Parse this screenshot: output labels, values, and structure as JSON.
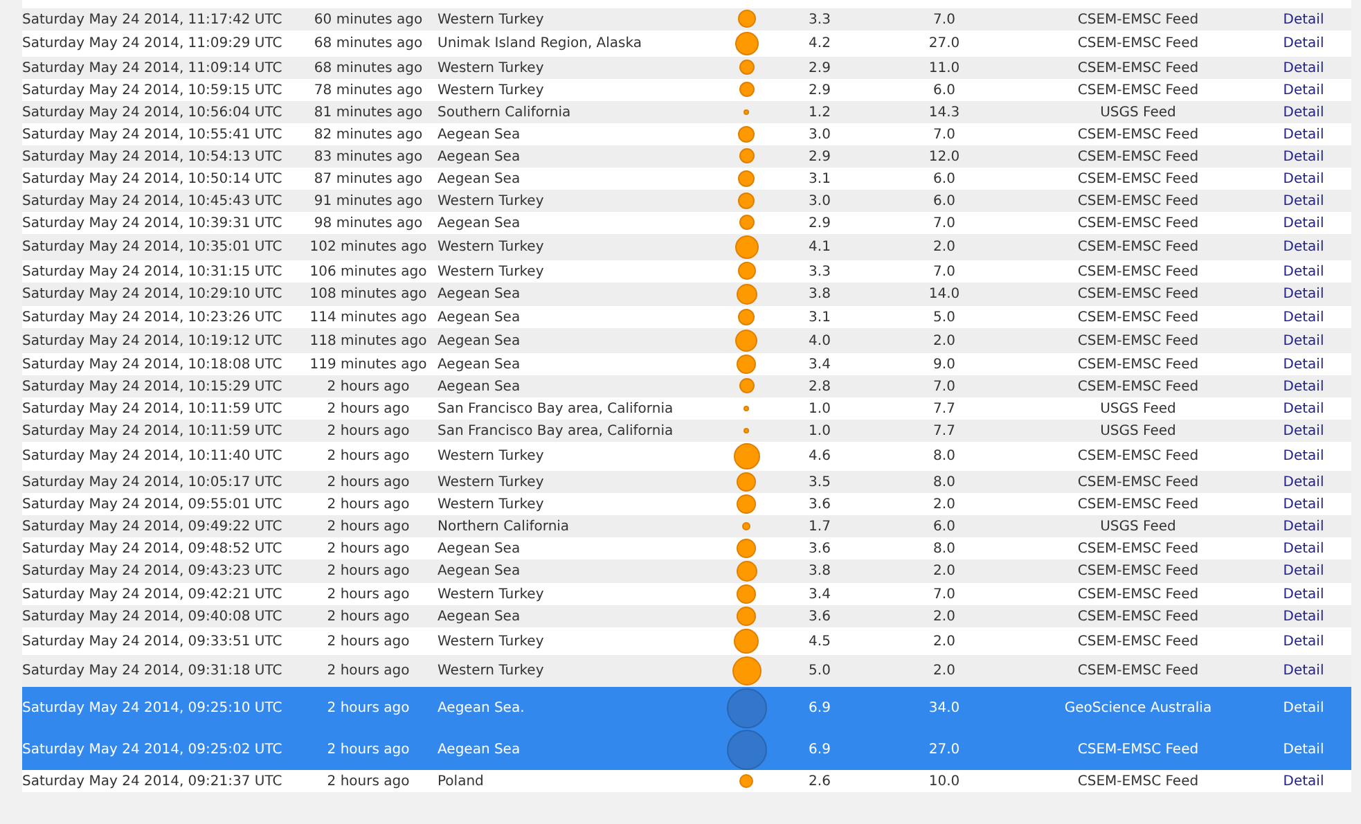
{
  "rows": [
    {
      "date": "Saturday May 24 2014, 11:17:42 UTC",
      "ago": "60 minutes ago",
      "region": "Western Turkey",
      "magnitude": "3.3",
      "depth": "7.0",
      "source": "CSEM-EMSC Feed",
      "link": "Detail",
      "selected": false
    },
    {
      "date": "Saturday May 24 2014, 11:09:29 UTC",
      "ago": "68 minutes ago",
      "region": "Unimak Island Region, Alaska",
      "magnitude": "4.2",
      "depth": "27.0",
      "source": "CSEM-EMSC Feed",
      "link": "Detail",
      "selected": false
    },
    {
      "date": "Saturday May 24 2014, 11:09:14 UTC",
      "ago": "68 minutes ago",
      "region": "Western Turkey",
      "magnitude": "2.9",
      "depth": "11.0",
      "source": "CSEM-EMSC Feed",
      "link": "Detail",
      "selected": false
    },
    {
      "date": "Saturday May 24 2014, 10:59:15 UTC",
      "ago": "78 minutes ago",
      "region": "Western Turkey",
      "magnitude": "2.9",
      "depth": "6.0",
      "source": "CSEM-EMSC Feed",
      "link": "Detail",
      "selected": false
    },
    {
      "date": "Saturday May 24 2014, 10:56:04 UTC",
      "ago": "81 minutes ago",
      "region": "Southern California",
      "magnitude": "1.2",
      "depth": "14.3",
      "source": "USGS Feed",
      "link": "Detail",
      "selected": false
    },
    {
      "date": "Saturday May 24 2014, 10:55:41 UTC",
      "ago": "82 minutes ago",
      "region": "Aegean Sea",
      "magnitude": "3.0",
      "depth": "7.0",
      "source": "CSEM-EMSC Feed",
      "link": "Detail",
      "selected": false
    },
    {
      "date": "Saturday May 24 2014, 10:54:13 UTC",
      "ago": "83 minutes ago",
      "region": "Aegean Sea",
      "magnitude": "2.9",
      "depth": "12.0",
      "source": "CSEM-EMSC Feed",
      "link": "Detail",
      "selected": false
    },
    {
      "date": "Saturday May 24 2014, 10:50:14 UTC",
      "ago": "87 minutes ago",
      "region": "Aegean Sea",
      "magnitude": "3.1",
      "depth": "6.0",
      "source": "CSEM-EMSC Feed",
      "link": "Detail",
      "selected": false
    },
    {
      "date": "Saturday May 24 2014, 10:45:43 UTC",
      "ago": "91 minutes ago",
      "region": "Western Turkey",
      "magnitude": "3.0",
      "depth": "6.0",
      "source": "CSEM-EMSC Feed",
      "link": "Detail",
      "selected": false
    },
    {
      "date": "Saturday May 24 2014, 10:39:31 UTC",
      "ago": "98 minutes ago",
      "region": "Aegean Sea",
      "magnitude": "2.9",
      "depth": "7.0",
      "source": "CSEM-EMSC Feed",
      "link": "Detail",
      "selected": false
    },
    {
      "date": "Saturday May 24 2014, 10:35:01 UTC",
      "ago": "102 minutes ago",
      "region": "Western Turkey",
      "magnitude": "4.1",
      "depth": "2.0",
      "source": "CSEM-EMSC Feed",
      "link": "Detail",
      "selected": false
    },
    {
      "date": "Saturday May 24 2014, 10:31:15 UTC",
      "ago": "106 minutes ago",
      "region": "Western Turkey",
      "magnitude": "3.3",
      "depth": "7.0",
      "source": "CSEM-EMSC Feed",
      "link": "Detail",
      "selected": false
    },
    {
      "date": "Saturday May 24 2014, 10:29:10 UTC",
      "ago": "108 minutes ago",
      "region": "Aegean Sea",
      "magnitude": "3.8",
      "depth": "14.0",
      "source": "CSEM-EMSC Feed",
      "link": "Detail",
      "selected": false
    },
    {
      "date": "Saturday May 24 2014, 10:23:26 UTC",
      "ago": "114 minutes ago",
      "region": "Aegean Sea",
      "magnitude": "3.1",
      "depth": "5.0",
      "source": "CSEM-EMSC Feed",
      "link": "Detail",
      "selected": false
    },
    {
      "date": "Saturday May 24 2014, 10:19:12 UTC",
      "ago": "118 minutes ago",
      "region": "Aegean Sea",
      "magnitude": "4.0",
      "depth": "2.0",
      "source": "CSEM-EMSC Feed",
      "link": "Detail",
      "selected": false
    },
    {
      "date": "Saturday May 24 2014, 10:18:08 UTC",
      "ago": "119 minutes ago",
      "region": "Aegean Sea",
      "magnitude": "3.4",
      "depth": "9.0",
      "source": "CSEM-EMSC Feed",
      "link": "Detail",
      "selected": false
    },
    {
      "date": "Saturday May 24 2014, 10:15:29 UTC",
      "ago": "2 hours ago",
      "region": "Aegean Sea",
      "magnitude": "2.8",
      "depth": "7.0",
      "source": "CSEM-EMSC Feed",
      "link": "Detail",
      "selected": false
    },
    {
      "date": "Saturday May 24 2014, 10:11:59 UTC",
      "ago": "2 hours ago",
      "region": "San Francisco Bay area, California",
      "magnitude": "1.0",
      "depth": "7.7",
      "source": "USGS Feed",
      "link": "Detail",
      "selected": false
    },
    {
      "date": "Saturday May 24 2014, 10:11:59 UTC",
      "ago": "2 hours ago",
      "region": "San Francisco Bay area, California",
      "magnitude": "1.0",
      "depth": "7.7",
      "source": "USGS Feed",
      "link": "Detail",
      "selected": false
    },
    {
      "date": "Saturday May 24 2014, 10:11:40 UTC",
      "ago": "2 hours ago",
      "region": "Western Turkey",
      "magnitude": "4.6",
      "depth": "8.0",
      "source": "CSEM-EMSC Feed",
      "link": "Detail",
      "selected": false
    },
    {
      "date": "Saturday May 24 2014, 10:05:17 UTC",
      "ago": "2 hours ago",
      "region": "Western Turkey",
      "magnitude": "3.5",
      "depth": "8.0",
      "source": "CSEM-EMSC Feed",
      "link": "Detail",
      "selected": false
    },
    {
      "date": "Saturday May 24 2014, 09:55:01 UTC",
      "ago": "2 hours ago",
      "region": "Western Turkey",
      "magnitude": "3.6",
      "depth": "2.0",
      "source": "CSEM-EMSC Feed",
      "link": "Detail",
      "selected": false
    },
    {
      "date": "Saturday May 24 2014, 09:49:22 UTC",
      "ago": "2 hours ago",
      "region": "Northern California",
      "magnitude": "1.7",
      "depth": "6.0",
      "source": "USGS Feed",
      "link": "Detail",
      "selected": false
    },
    {
      "date": "Saturday May 24 2014, 09:48:52 UTC",
      "ago": "2 hours ago",
      "region": "Aegean Sea",
      "magnitude": "3.6",
      "depth": "8.0",
      "source": "CSEM-EMSC Feed",
      "link": "Detail",
      "selected": false
    },
    {
      "date": "Saturday May 24 2014, 09:43:23 UTC",
      "ago": "2 hours ago",
      "region": "Aegean Sea",
      "magnitude": "3.8",
      "depth": "2.0",
      "source": "CSEM-EMSC Feed",
      "link": "Detail",
      "selected": false
    },
    {
      "date": "Saturday May 24 2014, 09:42:21 UTC",
      "ago": "2 hours ago",
      "region": "Western Turkey",
      "magnitude": "3.4",
      "depth": "7.0",
      "source": "CSEM-EMSC Feed",
      "link": "Detail",
      "selected": false
    },
    {
      "date": "Saturday May 24 2014, 09:40:08 UTC",
      "ago": "2 hours ago",
      "region": "Aegean Sea",
      "magnitude": "3.6",
      "depth": "2.0",
      "source": "CSEM-EMSC Feed",
      "link": "Detail",
      "selected": false
    },
    {
      "date": "Saturday May 24 2014, 09:33:51 UTC",
      "ago": "2 hours ago",
      "region": "Western Turkey",
      "magnitude": "4.5",
      "depth": "2.0",
      "source": "CSEM-EMSC Feed",
      "link": "Detail",
      "selected": false
    },
    {
      "date": "Saturday May 24 2014, 09:31:18 UTC",
      "ago": "2 hours ago",
      "region": "Western Turkey",
      "magnitude": "5.0",
      "depth": "2.0",
      "source": "CSEM-EMSC Feed",
      "link": "Detail",
      "selected": false
    },
    {
      "date": "Saturday May 24 2014, 09:25:10 UTC",
      "ago": "2 hours ago",
      "region": "Aegean Sea.",
      "magnitude": "6.9",
      "depth": "34.0",
      "source": "GeoScience Australia",
      "link": "Detail",
      "selected": true
    },
    {
      "date": "Saturday May 24 2014, 09:25:02 UTC",
      "ago": "2 hours ago",
      "region": "Aegean Sea",
      "magnitude": "6.9",
      "depth": "27.0",
      "source": "CSEM-EMSC Feed",
      "link": "Detail",
      "selected": true
    },
    {
      "date": "Saturday May 24 2014, 09:21:37 UTC",
      "ago": "2 hours ago",
      "region": "Poland",
      "magnitude": "2.6",
      "depth": "10.0",
      "source": "CSEM-EMSC Feed",
      "link": "Detail",
      "selected": false
    }
  ]
}
